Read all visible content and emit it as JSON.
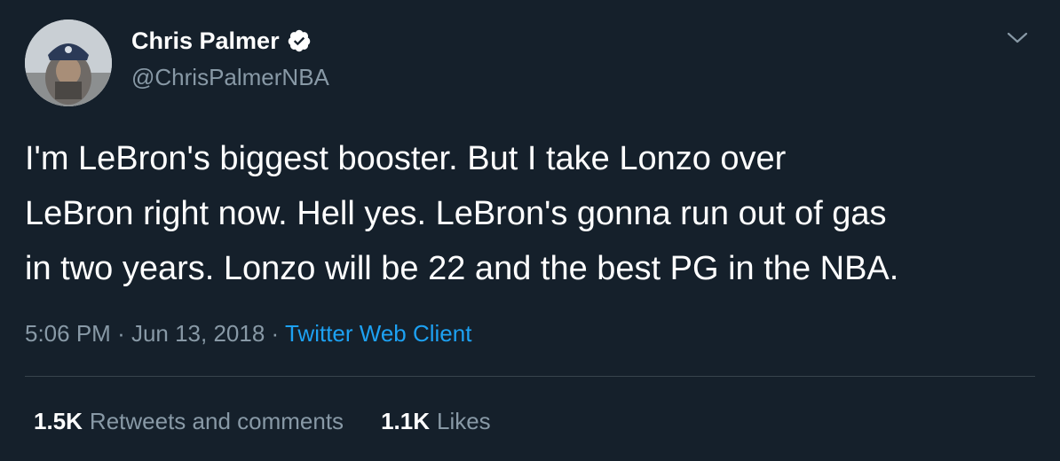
{
  "author": {
    "display_name": "Chris Palmer",
    "handle": "@ChrisPalmerNBA",
    "verified": true
  },
  "tweet": {
    "text": "I'm LeBron's biggest booster. But I take Lonzo over\nLeBron right now. Hell yes. LeBron's gonna run out of gas\nin two years. Lonzo will be 22 and the best PG in the NBA.",
    "time": "5:06 PM",
    "separator": "·",
    "date": "Jun 13, 2018",
    "source": "Twitter Web Client"
  },
  "stats": {
    "retweets_count": "1.5K",
    "retweets_label": "Retweets and comments",
    "likes_count": "1.1K",
    "likes_label": "Likes"
  },
  "icons": {
    "verified": "verified-badge-icon",
    "menu": "chevron-down-icon"
  },
  "colors": {
    "background": "#15202b",
    "text": "#ffffff",
    "secondary": "#8899a6",
    "accent": "#1da1f2",
    "divider": "#38444d"
  }
}
